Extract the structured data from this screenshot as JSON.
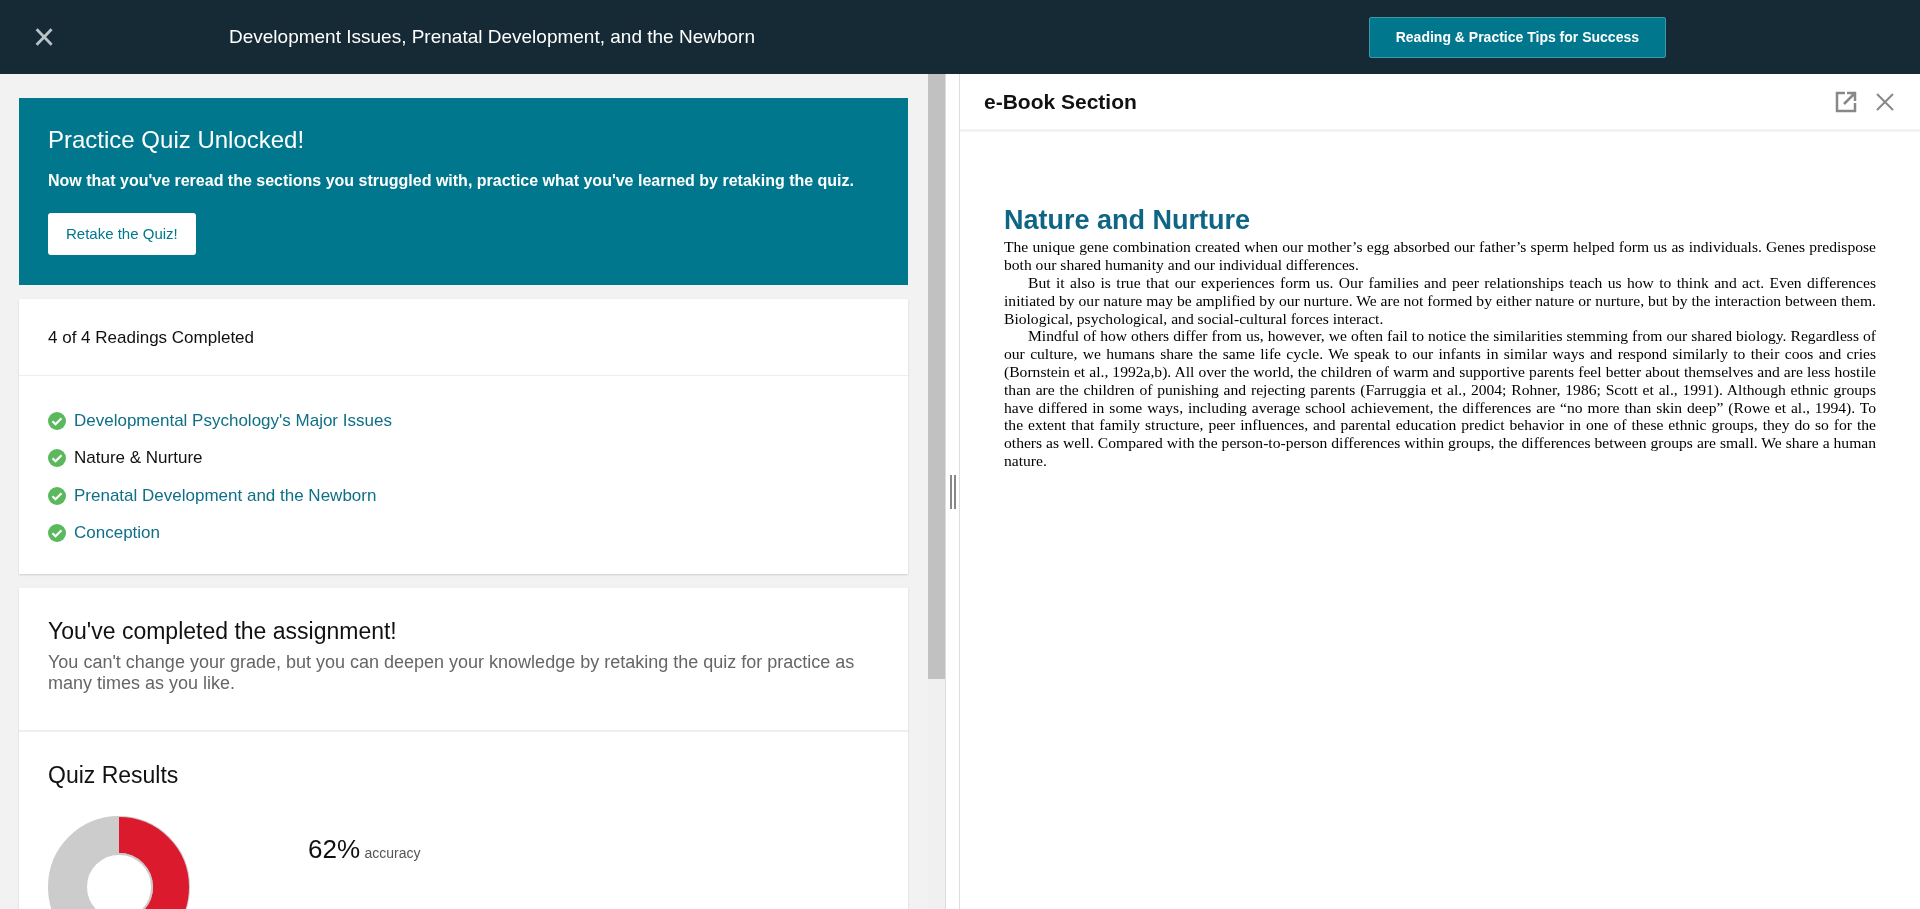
{
  "header": {
    "close": "×",
    "title": "Development Issues, Prenatal Development, and the Newborn",
    "tips_button": "Reading & Practice Tips for Success"
  },
  "unlock_card": {
    "title": "Practice Quiz Unlocked!",
    "message": "Now that you've reread the sections you struggled with, practice what you've learned by retaking the quiz.",
    "button": "Retake the Quiz!"
  },
  "readings": {
    "summary": "4 of 4 Readings Completed",
    "items": [
      {
        "label": "Developmental Psychology's Major Issues",
        "completed": true,
        "selected": false
      },
      {
        "label": "Nature & Nurture",
        "completed": true,
        "selected": true
      },
      {
        "label": "Prenatal Development and the Newborn",
        "completed": true,
        "selected": false
      },
      {
        "label": "Conception",
        "completed": true,
        "selected": false
      }
    ]
  },
  "completion": {
    "title": "You've completed the assignment!",
    "message": "You can't change your grade, but you can deepen your knowledge by retaking the quiz for practice as many times as you like."
  },
  "quiz_results": {
    "title": "Quiz Results",
    "percent": "62%",
    "percent_label": "accuracy"
  },
  "ebook": {
    "panel_title": "e-Book Section",
    "heading": "Nature and Nurture",
    "paragraphs": [
      "The unique gene combination created when our mother’s egg absorbed our father’s sperm helped form us as individuals. Genes predispose both our shared humanity and our individual differences.",
      "But it also is true that our experiences form us. Our families and peer relationships teach us how to think and act. Even differences initiated by our nature may be amplified by our nurture. We are not formed by either nature or nurture, but by the interaction between them. Biological, psychological, and social-cultural forces interact.",
      "Mindful of how others differ from us, however, we often fail to notice the similarities stemming from our shared biology. Regardless of our culture, we humans share the same life cycle. We speak to our infants in similar ways and respond similarly to their coos and cries (Bornstein et al., 1992a,b). All over the world, the children of warm and supportive parents feel better about themselves and are less hostile than are the children of punishing and rejecting parents (Farruggia et al., 2004; Rohner, 1986; Scott et al., 1991). Although ethnic groups have differed in some ways, including average school achievement, the differences are “no more than skin deep” (Rowe et al., 1994). To the extent that family structure, peer influences, and parental education predict behavior in one of these ethnic groups, they do so for the others as well. Compared with the person-to-person differences within groups, the differences between groups are small. We share a human nature."
    ]
  }
}
